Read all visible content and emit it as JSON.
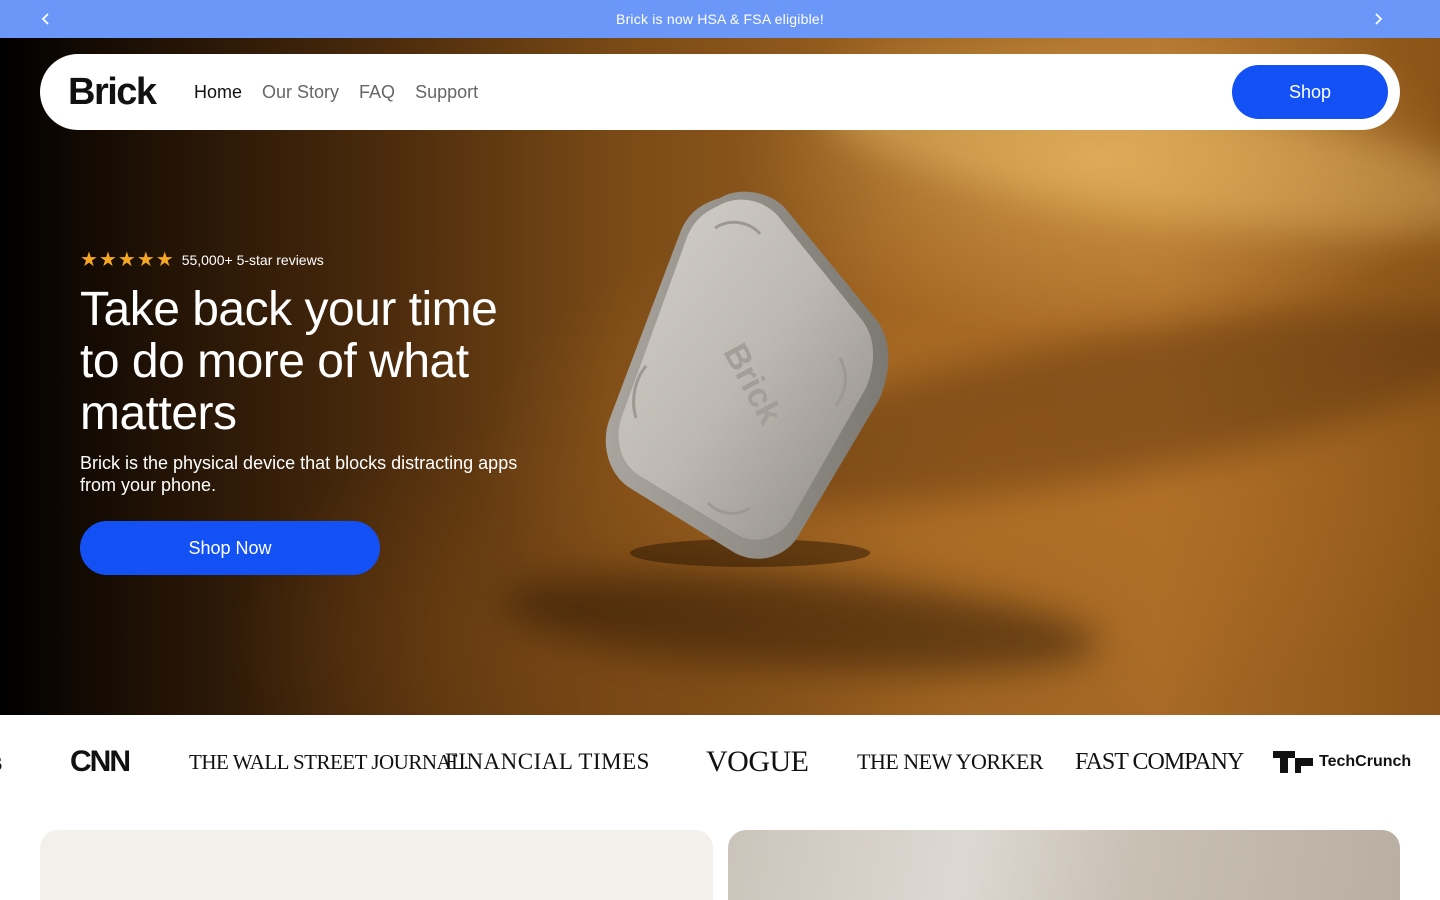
{
  "announcement": {
    "text": "Brick is now HSA & FSA eligible!",
    "prev_icon": "chevron-left-icon",
    "next_icon": "chevron-right-icon"
  },
  "header": {
    "logo": "Brick",
    "nav": [
      {
        "label": "Home",
        "active": true
      },
      {
        "label": "Our Story",
        "active": false
      },
      {
        "label": "FAQ",
        "active": false
      },
      {
        "label": "Support",
        "active": false
      }
    ],
    "shop_label": "Shop"
  },
  "hero": {
    "rating_stars": 5,
    "reviews_text": "55,000+ 5-star reviews",
    "headline": "Take back your time to do more of what matters",
    "subtext": "Brick is the physical device that blocks distracting apps from your phone.",
    "cta_label": "Shop Now",
    "device_engraving": "Brick"
  },
  "press": {
    "cut_logo": "s",
    "logos": [
      "CNN",
      "THE WALL STREET JOURNAL.",
      "FINANCIAL TIMES",
      "VOGUE",
      "THE NEW YORKER",
      "FAST COMPANY",
      "TechCrunch"
    ]
  },
  "colors": {
    "announcement_bg": "#6b97f8",
    "accent_blue": "#1351f5",
    "star": "#f5a623"
  }
}
